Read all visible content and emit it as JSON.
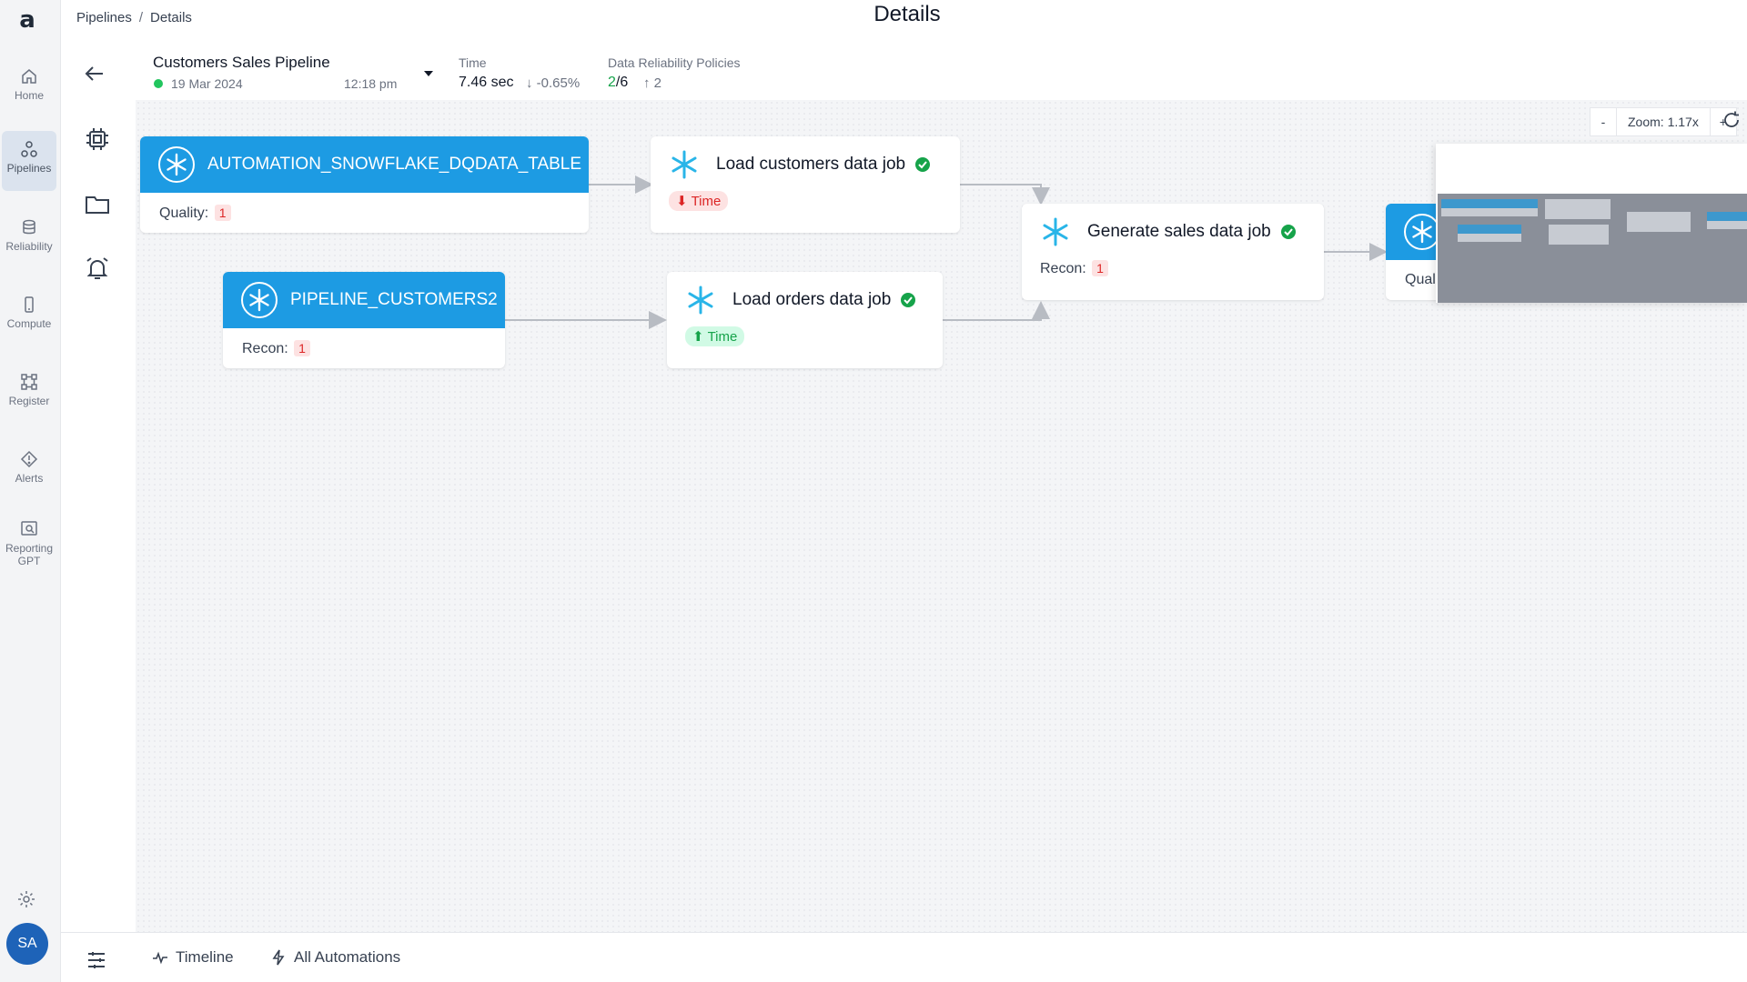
{
  "breadcrumb": {
    "root": "Pipelines",
    "separator": "/",
    "current": "Details"
  },
  "page_title": "Details",
  "nav": {
    "items": [
      {
        "label": "Home",
        "icon": "home-icon"
      },
      {
        "label": "Pipelines",
        "icon": "pipelines-icon",
        "active": true
      },
      {
        "label": "Reliability",
        "icon": "database-icon"
      },
      {
        "label": "Compute",
        "icon": "compute-icon"
      },
      {
        "label": "Register",
        "icon": "register-icon"
      },
      {
        "label": "Alerts",
        "icon": "alert-diamond-icon"
      },
      {
        "label": "Reporting GPT",
        "icon": "reporting-icon"
      }
    ],
    "avatar": "SA"
  },
  "pipeline": {
    "name": "Customers Sales Pipeline",
    "date": "19 Mar 2024",
    "time": "12:18 pm",
    "status_color": "#22c55e"
  },
  "metrics": {
    "time_label": "Time",
    "time_value": "7.46 sec",
    "time_delta": "-0.65%",
    "drp_label": "Data Reliability Policies",
    "drp_passed": "2",
    "drp_total": "/6",
    "drp_up": "2"
  },
  "nodes": [
    {
      "title": "AUTOMATION_SNOWFLAKE_DQDATA_TABLE",
      "metric_label": "Quality:",
      "metric_value": "1"
    },
    {
      "title": "PIPELINE_CUSTOMERS2",
      "metric_label": "Recon:",
      "metric_value": "1"
    },
    {
      "title": "",
      "metric_label": "Qual"
    }
  ],
  "jobs": [
    {
      "title": "Load customers data job",
      "pill": "Time",
      "pill_trend": "down"
    },
    {
      "title": "Load orders data job",
      "pill": "Time",
      "pill_trend": "up"
    },
    {
      "title": "Generate sales data job",
      "metric_label": "Recon:",
      "metric_value": "1"
    }
  ],
  "zoom": {
    "minus": "-",
    "label": "Zoom: 1.17x",
    "plus": "+"
  },
  "footer": {
    "timeline": "Timeline",
    "automations": "All Automations"
  },
  "colors": {
    "accent": "#1d9be3",
    "success": "#16a34a",
    "danger": "#dc2626",
    "avatar": "#1e63b8"
  }
}
